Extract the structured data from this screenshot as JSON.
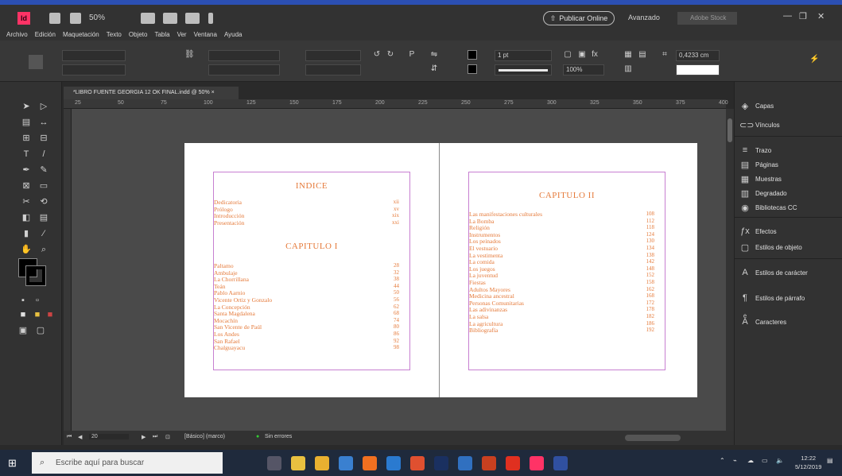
{
  "titlebar": {
    "app_logo": "Id",
    "zoom": "50%",
    "share_label": "Publicar Online",
    "workspace": "Avanzado",
    "search_placeholder": "Adobe Stock"
  },
  "menu": [
    "Archivo",
    "Edición",
    "Maquetación",
    "Texto",
    "Objeto",
    "Tabla",
    "Ver",
    "Ventana",
    "Ayuda"
  ],
  "controlbar": {
    "stroke_weight": "1 pt",
    "percent": "100%",
    "width_value": "0,4233 cm"
  },
  "document": {
    "tab_label": "*LIBRO FUENTE GEORGIA 12 OK FINAL.indd @ 50% ×",
    "ruler_ticks": [
      "25",
      "50",
      "75",
      "100",
      "125",
      "150",
      "175",
      "200",
      "225",
      "250",
      "275",
      "300",
      "325",
      "350",
      "375",
      "400"
    ]
  },
  "left_page": {
    "heading": "INDICE",
    "intro": [
      {
        "label": "Dedicatoria",
        "page": "xii"
      },
      {
        "label": "Prólogo",
        "page": "xv"
      },
      {
        "label": "Introducción",
        "page": "xix"
      },
      {
        "label": "Presentación",
        "page": "xxi"
      }
    ],
    "chapter_heading": "CAPITULO I",
    "chapter_items": [
      {
        "label": "Paltamo",
        "page": "28"
      },
      {
        "label": "Ambulaje",
        "page": "32"
      },
      {
        "label": "La Chorrillana",
        "page": "38"
      },
      {
        "label": "Teán",
        "page": "44"
      },
      {
        "label": "Pablo Aarnio",
        "page": "50"
      },
      {
        "label": "Vicente Ortiz y Gonzalo",
        "page": "56"
      },
      {
        "label": "La Concepción",
        "page": "62"
      },
      {
        "label": "Santa Magdalena",
        "page": "68"
      },
      {
        "label": "Mocachín",
        "page": "74"
      },
      {
        "label": "San Vicente de Paúl",
        "page": "80"
      },
      {
        "label": "Los Andes",
        "page": "86"
      },
      {
        "label": "San Rafael",
        "page": "92"
      },
      {
        "label": "Chalguayacu",
        "page": "98"
      }
    ]
  },
  "right_page": {
    "heading": "CAPITULO II",
    "items": [
      {
        "label": "Las manifestaciones culturales",
        "page": "108"
      },
      {
        "label": "La Bomba",
        "page": "112"
      },
      {
        "label": "Religión",
        "page": "118"
      },
      {
        "label": "Instrumentos",
        "page": "124"
      },
      {
        "label": "Los peinados",
        "page": "130"
      },
      {
        "label": "El vestuario",
        "page": "134"
      },
      {
        "label": "La vestimenta",
        "page": "138"
      },
      {
        "label": "La comida",
        "page": "142"
      },
      {
        "label": "Los juegos",
        "page": "148"
      },
      {
        "label": "La juventud",
        "page": "152"
      },
      {
        "label": "Fiestas",
        "page": "158"
      },
      {
        "label": "Adultos Mayores",
        "page": "162"
      },
      {
        "label": "Medicina ancestral",
        "page": "168"
      },
      {
        "label": "Personas Comunitarias",
        "page": "172"
      },
      {
        "label": "Las adivinanzas",
        "page": "178"
      },
      {
        "label": "La salsa",
        "page": "182"
      },
      {
        "label": "La agricultura",
        "page": "186"
      },
      {
        "label": "Bibliografía",
        "page": "192"
      }
    ]
  },
  "statusbar": {
    "page_number": "20",
    "style_label": "[Básico] (marco)",
    "errors": "Sin errores"
  },
  "panels": [
    {
      "icon": "layers-icon",
      "label": "Capas"
    },
    {
      "icon": "links-icon",
      "label": "Vínculos"
    },
    {
      "icon": "stroke-icon",
      "label": "Trazo"
    },
    {
      "icon": "pages-icon",
      "label": "Páginas"
    },
    {
      "icon": "swatches-icon",
      "label": "Muestras"
    },
    {
      "icon": "gradient-icon",
      "label": "Degradado"
    },
    {
      "icon": "cc-libraries-icon",
      "label": "Bibliotecas CC"
    },
    {
      "icon": "effects-icon",
      "label": "Efectos"
    },
    {
      "icon": "object-styles-icon",
      "label": "Estilos de objeto"
    },
    {
      "icon": "character-styles-icon",
      "label": "Estilos de carácter"
    },
    {
      "icon": "paragraph-styles-icon",
      "label": "Estilos de párrafo"
    },
    {
      "icon": "glyphs-icon",
      "label": "Caracteres"
    }
  ],
  "taskbar": {
    "search_placeholder": "Escribe aquí para buscar",
    "time": "12:22",
    "date": "5/12/2019"
  },
  "colors": {
    "toc_text": "#e57a3a",
    "margin_guide": "#c77fd1",
    "accent": "#2b4fb3"
  }
}
